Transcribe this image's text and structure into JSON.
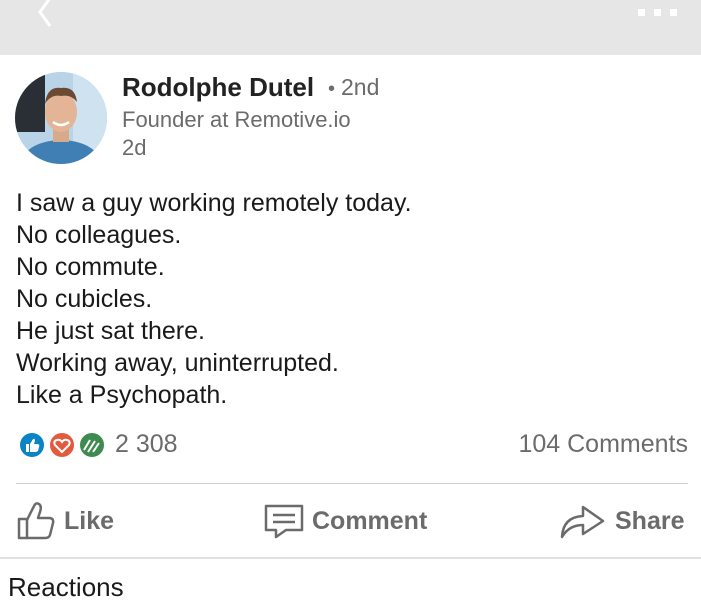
{
  "topbar": {
    "back_icon": "chevron-left-icon",
    "more_icon": "more-horizontal-icon"
  },
  "post": {
    "author": {
      "name": "Rodolphe Dutel",
      "degree": "2nd",
      "headline": "Founder at Remotive.io",
      "avatar_icon": "avatar-photo"
    },
    "time": "2d",
    "body_lines": [
      "I saw a guy working remotely today.",
      "No colleagues.",
      "No commute.",
      "No cubicles.",
      "He just sat there.",
      "Working away, uninterrupted.",
      "Like a Psychopath."
    ]
  },
  "social": {
    "reaction_icons": [
      "like-icon",
      "love-icon",
      "insightful-icon"
    ],
    "reaction_count": "2 308",
    "comments_count": "104 Comments"
  },
  "actions": {
    "like": "Like",
    "comment": "Comment",
    "share": "Share"
  },
  "reactions_section": {
    "heading": "Reactions"
  },
  "colors": {
    "topbar_bg": "#e6e6e6",
    "like_blue": "#0a84c4",
    "love_red": "#e35b3e",
    "insightful_green": "#3d8b4f",
    "muted_text": "#6b6b6b"
  }
}
